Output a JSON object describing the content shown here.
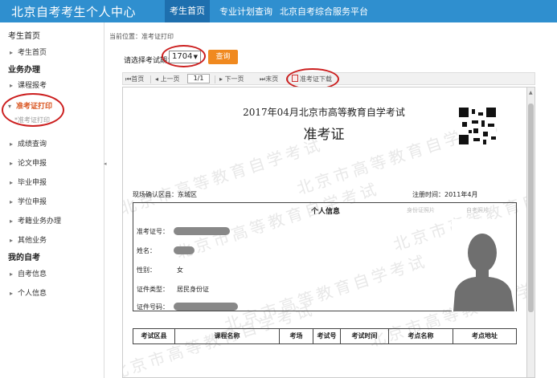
{
  "header": {
    "site_title": "北京自考考生个人中心",
    "nav": [
      "考生首页",
      "专业计划查询",
      "北京自考综合服务平台"
    ]
  },
  "sidebar": {
    "home": "考生首页",
    "groups": [
      {
        "title": "业务办理"
      },
      {
        "title": "我的自考"
      }
    ],
    "items": [
      {
        "label": "考生首页"
      },
      {
        "label": "课程报考"
      },
      {
        "label": "准考证打印"
      },
      {
        "label": "成绩查询"
      },
      {
        "label": "论文申报"
      },
      {
        "label": "毕业申报"
      },
      {
        "label": "学位申报"
      },
      {
        "label": "考籍业务办理"
      },
      {
        "label": "其他业务"
      },
      {
        "label": "自考信息"
      },
      {
        "label": "个人信息"
      }
    ],
    "sub_item": "*准考证打印"
  },
  "main": {
    "breadcrumb": "当前位置：准考证打印",
    "term_label": "请选择考试期：",
    "term_value": "1704",
    "query_label": "查询",
    "toolbar": {
      "first": "首页",
      "prev": "上一页",
      "page": "1/1",
      "next": "下一页",
      "last": "末页",
      "download": "准考证下载"
    }
  },
  "card": {
    "exam_title": "2017年04月北京市高等教育自学考试",
    "title": "准考证",
    "watermark": "北京市高等教育自学考试",
    "region_label": "现场确认区县：东城区",
    "reg_date_label": "注册时间：2011年4月",
    "info_header": "个人信息",
    "photo_col1": "身份证照片",
    "photo_col2": "自考照片",
    "fields": [
      {
        "label": "准考证号：",
        "value": ""
      },
      {
        "label": "姓名：",
        "value": ""
      },
      {
        "label": "性别：",
        "value": "女"
      },
      {
        "label": "证件类型：",
        "value": "居民身份证"
      },
      {
        "label": "证件号码：",
        "value": ""
      }
    ],
    "table_headers": [
      "考试区县",
      "课程名称",
      "考场",
      "考试号",
      "考试时间",
      "考点名称",
      "考点地址"
    ]
  },
  "colors": {
    "header_bg": "#2f8fcf",
    "accent": "#f0891f",
    "annotation": "#cc1f1f",
    "active_text": "#d9541e"
  }
}
